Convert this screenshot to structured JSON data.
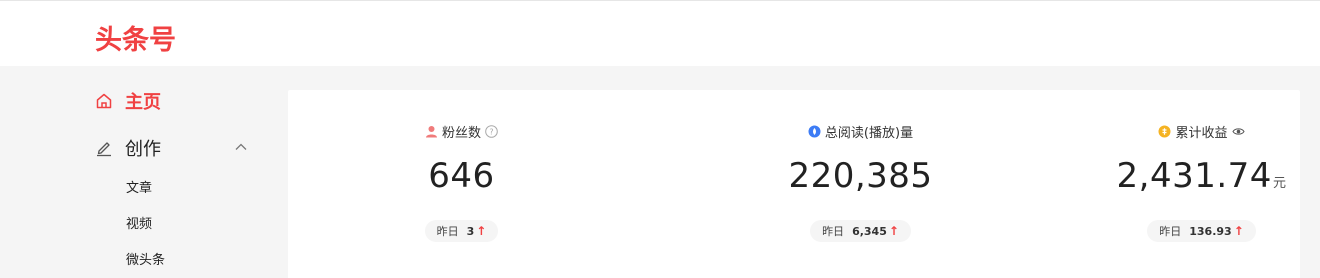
{
  "header": {
    "logo_text": "头条号"
  },
  "sidebar": {
    "home": {
      "label": "主页",
      "icon": "home-icon"
    },
    "create": {
      "label": "创作",
      "icon": "pen-icon",
      "expanded": true
    },
    "create_items": [
      "文章",
      "视频",
      "微头条"
    ]
  },
  "stats": [
    {
      "label": "粉丝数",
      "icon": "user-icon",
      "value": "646",
      "unit": "",
      "yesterday_label": "昨日",
      "yesterday_value": "3",
      "trend": "↑",
      "extra_icon": "help-icon"
    },
    {
      "label": "总阅读(播放)量",
      "icon": "read-icon",
      "value": "220,385",
      "unit": "",
      "yesterday_label": "昨日",
      "yesterday_value": "6,345",
      "trend": "↑",
      "extra_icon": ""
    },
    {
      "label": "累计收益",
      "icon": "coin-icon",
      "value": "2,431.74",
      "unit": "元",
      "yesterday_label": "昨日",
      "yesterday_value": "136.93",
      "trend": "↑",
      "extra_icon": "eye-icon"
    }
  ],
  "colors": {
    "accent": "#f04142",
    "read_blue": "#3d7cf5",
    "coin_gold": "#f5b323"
  }
}
